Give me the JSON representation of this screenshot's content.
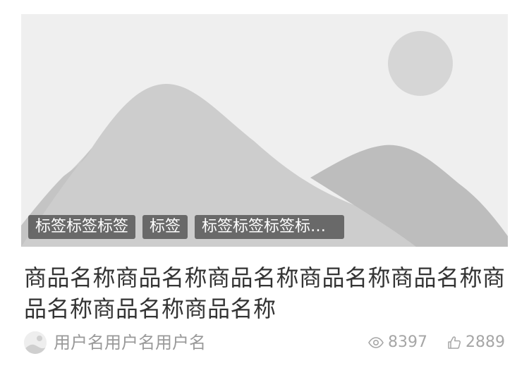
{
  "tags": [
    "标签标签标签",
    "标签",
    "标签标签标签标签标签标签"
  ],
  "title": "商品名称商品名称商品名称商品名称商品名称商品名称商品名称商品名称",
  "user": {
    "name": "用户名用户名用户名"
  },
  "stats": {
    "views": "8397",
    "likes": "2889"
  },
  "icons": {
    "views": "eye-icon",
    "likes": "thumbs-up-icon",
    "image": "image-placeholder-icon"
  },
  "colors": {
    "tag_bg": "#505050",
    "text_primary": "#333333",
    "text_secondary": "#999999"
  }
}
